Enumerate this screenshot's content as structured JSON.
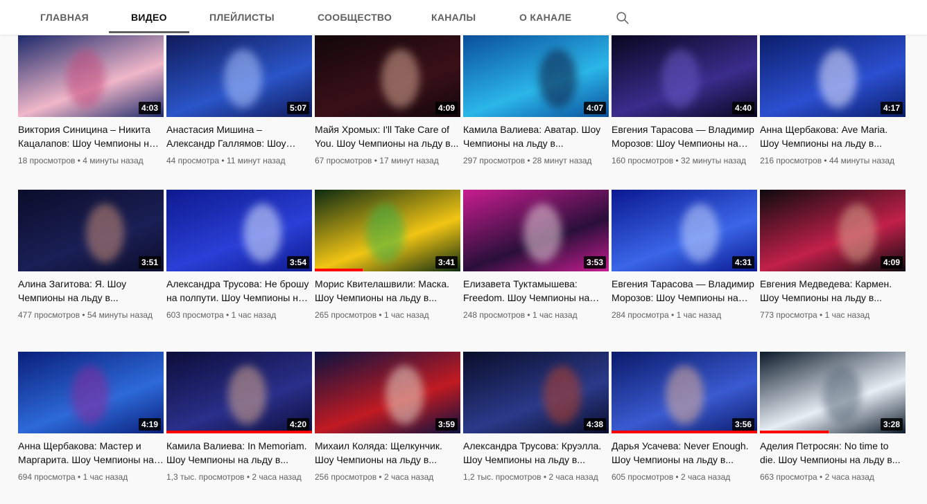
{
  "tabs": [
    {
      "label": "ГЛАВНАЯ"
    },
    {
      "label": "ВИДЕО",
      "active": true
    },
    {
      "label": "ПЛЕЙЛИСТЫ"
    },
    {
      "label": "СООБЩЕСТВО"
    },
    {
      "label": "КАНАЛЫ"
    },
    {
      "label": "О КАНАЛЕ"
    }
  ],
  "search_icon": "search-icon",
  "videos": [
    {
      "title": "Виктория Синицина – Никита Кацалапов: Шоу Чемпионы на льду в...",
      "duration": "4:03",
      "views": "18 просмотров",
      "time": "4 минуты назад",
      "colors": [
        "#1d2a6b",
        "#f0b7c9",
        "#c24a7d"
      ]
    },
    {
      "title": "Анастасия Мишина – Александр Галлямов: Шоу Чемпионы на льду в...",
      "duration": "5:07",
      "views": "44 просмотра",
      "time": "11 минут назад",
      "colors": [
        "#101a5a",
        "#2a55c8",
        "#b0c8ff"
      ]
    },
    {
      "title": "Майя Хромых: I'll Take Care of You. Шоу Чемпионы на льду в...",
      "duration": "4:09",
      "views": "67 просмотров",
      "time": "17 минут назад",
      "colors": [
        "#12070a",
        "#3a1018",
        "#d9a995"
      ]
    },
    {
      "title": "Камила Валиева: Аватар. Шоу Чемпионы на льду в...",
      "duration": "4:07",
      "views": "297 просмотров",
      "time": "28 минут назад",
      "colors": [
        "#0a4f9a",
        "#2bb6e8",
        "#0c1a40"
      ]
    },
    {
      "title": "Евгения Тарасова — Владимир Морозов: Шоу Чемпионы на льду в...",
      "duration": "4:40",
      "views": "160 просмотров",
      "time": "32 минуты назад",
      "colors": [
        "#07061f",
        "#3b2c8c",
        "#6a5ac8"
      ]
    },
    {
      "title": "Анна Щербакова: Ave Maria. Шоу Чемпионы на льду в...",
      "duration": "4:17",
      "views": "216 просмотров",
      "time": "44 минуты назад",
      "colors": [
        "#0b1e6b",
        "#2b4fd0",
        "#e8e8ff"
      ]
    },
    {
      "title": "Алина Загитова: Я. Шоу Чемпионы на льду в...",
      "duration": "3:51",
      "views": "477 просмотров",
      "time": "54 минуты назад",
      "colors": [
        "#0b0d2a",
        "#1a1f55",
        "#c98e79"
      ]
    },
    {
      "title": "Александра Трусова: Не брошу на полпути. Шоу Чемпионы на льду в...",
      "duration": "3:54",
      "views": "603 просмотра",
      "time": "1 час назад",
      "colors": [
        "#0d1a8f",
        "#2a3fd6",
        "#dfe9ff"
      ]
    },
    {
      "title": "Морис Квителашвили: Маска. Шоу Чемпионы на льду в...",
      "duration": "3:41",
      "views": "265 просмотров",
      "time": "1 час назад",
      "colors": [
        "#0c2a12",
        "#f2c514",
        "#3bb34a"
      ],
      "progress": 0.33
    },
    {
      "title": "Елизавета Туктамышева: Freedom. Шоу Чемпионы на льду в...",
      "duration": "3:53",
      "views": "248 просмотров",
      "time": "1 час назад",
      "colors": [
        "#c81d8f",
        "#2a0f3a",
        "#f0d0e0"
      ]
    },
    {
      "title": "Евгения Тарасова — Владимир Морозов: Шоу Чемпионы на льду в...",
      "duration": "4:31",
      "views": "284 просмотра",
      "time": "1 час назад",
      "colors": [
        "#0a1890",
        "#3a66e8",
        "#c7d6ff"
      ]
    },
    {
      "title": "Евгения Медведева: Кармен. Шоу Чемпионы на льду в...",
      "duration": "4:09",
      "views": "773 просмотра",
      "time": "1 час назад",
      "colors": [
        "#0d0b0e",
        "#c2204a",
        "#d8a48c"
      ]
    },
    {
      "title": "Анна Щербакова: Мастер и Маргарита. Шоу Чемпионы на льду в...",
      "duration": "4:19",
      "views": "694 просмотра",
      "time": "1 час назад",
      "colors": [
        "#0a1f7a",
        "#2d6ad8",
        "#8a2a9c"
      ]
    },
    {
      "title": "Камила Валиева: In Memoriam. Шоу Чемпионы на льду в...",
      "duration": "4:20",
      "views": "1,3 тыс. просмотров",
      "time": "2 часа назад",
      "colors": [
        "#0c0d3a",
        "#2a2f8a",
        "#d8a98f"
      ],
      "progress": 1.0
    },
    {
      "title": "Михаил Коляда: Щелкунчик. Шоу Чемпионы на льду в...",
      "duration": "3:59",
      "views": "256 просмотров",
      "time": "2 часа назад",
      "colors": [
        "#0a1240",
        "#c11a22",
        "#e8d8c8"
      ]
    },
    {
      "title": "Александра Трусова: Круэлла. Шоу Чемпионы на льду в...",
      "duration": "4:38",
      "views": "1,2 тыс. просмотров",
      "time": "2 часа назад",
      "colors": [
        "#0a0d2a",
        "#2a3a8a",
        "#b5402a"
      ]
    },
    {
      "title": "Дарья Усачева: Never Enough. Шоу Чемпионы на льду в...",
      "duration": "3:56",
      "views": "605 просмотров",
      "time": "2 часа назад",
      "colors": [
        "#0a1a6a",
        "#3a5ad0",
        "#e0b09a"
      ],
      "progress": 1.0
    },
    {
      "title": "Аделия Петросян: No time to die. Шоу Чемпионы на льду в...",
      "duration": "3:28",
      "views": "663 просмотра",
      "time": "2 часа назад",
      "colors": [
        "#0c1a2a",
        "#e8eef5",
        "#5a6a7a"
      ],
      "progress": 0.47
    }
  ]
}
